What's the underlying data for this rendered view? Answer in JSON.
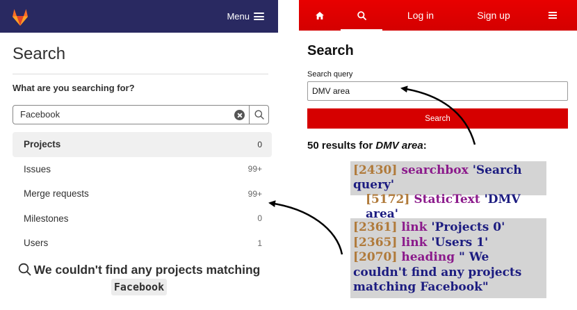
{
  "gitlab": {
    "menu_label": "Menu",
    "page_title": "Search",
    "question": "What are you searching for?",
    "search_value": "Facebook",
    "nav": [
      {
        "label": "Projects",
        "count": "0",
        "active": true
      },
      {
        "label": "Issues",
        "count": "99+",
        "active": false
      },
      {
        "label": "Merge requests",
        "count": "99+",
        "active": false
      },
      {
        "label": "Milestones",
        "count": "0",
        "active": false
      },
      {
        "label": "Users",
        "count": "1",
        "active": false
      }
    ],
    "empty_message": "We couldn't find any projects matching",
    "empty_term": "Facebook",
    "colors": {
      "header": "#292961",
      "logo": "#e24329"
    }
  },
  "osm": {
    "tabs": [
      {
        "label": "",
        "icon": "home-icon"
      },
      {
        "label": "",
        "icon": "search-icon",
        "active": true
      },
      {
        "label": "Log in"
      },
      {
        "label": "Sign up"
      },
      {
        "label": "",
        "icon": "hamburger-menu-icon"
      }
    ],
    "page_title": "Search",
    "field_label": "Search query",
    "search_value": "DMV area",
    "search_button": "Search",
    "results_prefix": "50 results for ",
    "results_term": "DMV area",
    "results_suffix": ":",
    "colors": {
      "header": "#e30000",
      "button": "#d60000"
    }
  },
  "annotations": {
    "top": [
      {
        "id": "[2430]",
        "role": "searchbox",
        "text": "'Search query'"
      },
      {
        "id": "[5172]",
        "role": "StaticText",
        "text": "'DMV area'"
      }
    ],
    "bottom": [
      {
        "id": "[2361]",
        "role": "link",
        "text": "'Projects 0'"
      },
      {
        "id": "[2365]",
        "role": "link",
        "text": "'Users 1'"
      },
      {
        "id": "[2070]",
        "role": "heading",
        "text": "\" We couldn't find any projects matching Facebook\""
      }
    ]
  }
}
